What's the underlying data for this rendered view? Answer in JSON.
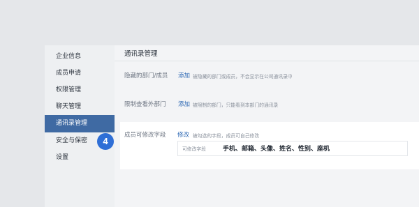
{
  "sidebar": {
    "items": [
      {
        "label": "企业信息"
      },
      {
        "label": "成员申请"
      },
      {
        "label": "权限管理"
      },
      {
        "label": "聊天管理"
      },
      {
        "label": "通讯录管理"
      },
      {
        "label": "安全与保密"
      },
      {
        "label": "设置"
      }
    ],
    "active_index": 4
  },
  "main": {
    "title": "通讯录管理",
    "rows": [
      {
        "label": "隐藏的部门/成员",
        "action": "添加",
        "description": "被隐藏的部门或成员，不会显示在公司通讯录中"
      },
      {
        "label": "限制查看外部门",
        "action": "添加",
        "description": "被限制的部门，只能看到本部门的通讯录"
      }
    ],
    "editable_fields": {
      "label": "成员可修改字段",
      "action": "修改",
      "description": "被勾选的字段，成员可自己修改",
      "box_label": "可修改字段",
      "box_value": "手机、邮箱、头像、姓名、性别、座机"
    }
  },
  "step_badge": "4",
  "colors": {
    "accent": "#3f6aa3",
    "link": "#2f6ab5",
    "badge": "#2f6fd6"
  }
}
